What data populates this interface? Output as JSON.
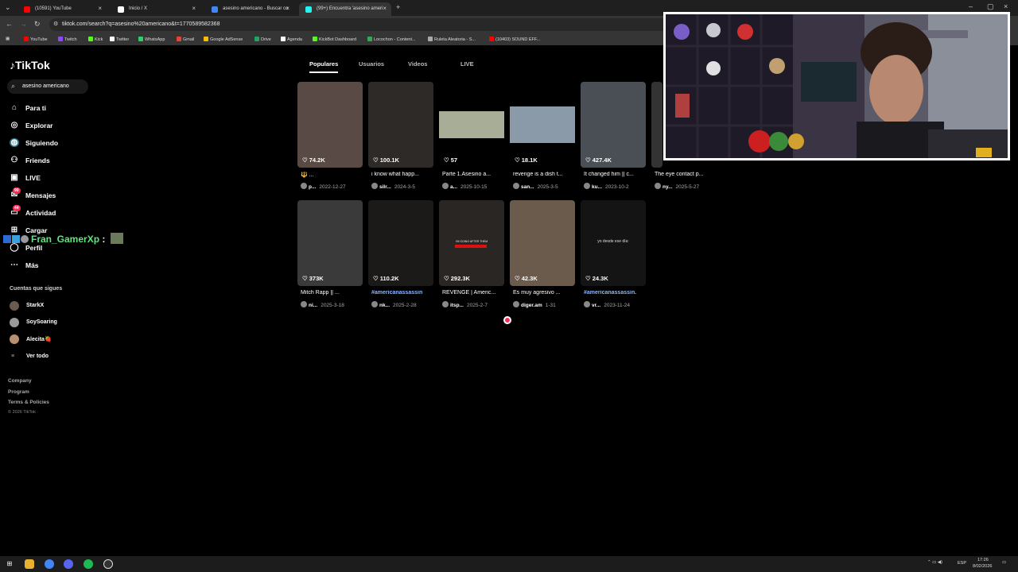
{
  "browser": {
    "tabs": [
      {
        "title": "(10591) YouTube",
        "active": false,
        "color": "#ff0000"
      },
      {
        "title": "Inicio / X",
        "active": false,
        "color": "#ffffff"
      },
      {
        "title": "asesino americano - Buscar co",
        "active": false,
        "color": "#4285f4"
      },
      {
        "title": "(99+) Encuentra 'asesino ameri",
        "active": true,
        "color": "#25f4ee"
      }
    ],
    "url": "tiktok.com/search?q=asesino%20americano&t=1770589582368",
    "bookmarks": [
      {
        "label": "YouTube",
        "color": "#ff0000"
      },
      {
        "label": "Twitch",
        "color": "#9146ff"
      },
      {
        "label": "Kick",
        "color": "#53fc18"
      },
      {
        "label": "Twitter",
        "color": "#ffffff"
      },
      {
        "label": "WhatsApp",
        "color": "#25d366"
      },
      {
        "label": "Gmail",
        "color": "#ea4335"
      },
      {
        "label": "Google AdSense",
        "color": "#fbbc04"
      },
      {
        "label": "Drive",
        "color": "#1fa463"
      },
      {
        "label": "Agenda",
        "color": "#ffffff"
      },
      {
        "label": "KickBot Dashboard",
        "color": "#53fc18"
      },
      {
        "label": "Locochon - Content...",
        "color": "#34a853"
      },
      {
        "label": "Ruleta Aleatoria - S...",
        "color": "#aaaaaa"
      },
      {
        "label": "(10403) SOUND EFF...",
        "color": "#ff0000"
      }
    ]
  },
  "sidebar": {
    "logo": "TikTok",
    "search_value": "asesino americano",
    "items": [
      {
        "label": "Para ti",
        "icon": "home-icon"
      },
      {
        "label": "Explorar",
        "icon": "compass-icon"
      },
      {
        "label": "Siguiendo",
        "icon": "following-icon"
      },
      {
        "label": "Friends",
        "icon": "friends-icon"
      },
      {
        "label": "LIVE",
        "icon": "live-icon"
      },
      {
        "label": "Mensajes",
        "icon": "message-icon",
        "badge": "99"
      },
      {
        "label": "Actividad",
        "icon": "activity-icon",
        "badge": "44"
      },
      {
        "label": "Cargar",
        "icon": "upload-icon"
      },
      {
        "label": "Perfil",
        "icon": "profile-icon"
      },
      {
        "label": "Más",
        "icon": "more-icon"
      }
    ],
    "following_title": "Cuentas que sigues",
    "following": [
      "StarkX",
      "SoySoaring",
      "Alecita🍓"
    ],
    "see_all": "Ver todo",
    "footer": [
      "Company",
      "Program",
      "Terms & Policies"
    ],
    "copyright": "© 2026 TikTok"
  },
  "overlay_chat": {
    "user": "Fran_GamerXp",
    "sep": ":"
  },
  "search_tabs": [
    "Populares",
    "Usuarios",
    "Videos",
    "LIVE"
  ],
  "videos": [
    {
      "likes": "74.2K",
      "desc": "🔱 ...",
      "user": "p...",
      "date": "2022-12-27",
      "tag": false,
      "thumb": "#5a4a45"
    },
    {
      "likes": "100.1K",
      "desc": "i know what happ...",
      "user": "silr...",
      "date": "2024-3-5",
      "tag": false,
      "thumb": "#2e2a28"
    },
    {
      "likes": "57",
      "desc": "Parte 1.Asesino a...",
      "user": "a...",
      "date": "2025-10-15",
      "tag": false,
      "thumb": "#000000"
    },
    {
      "likes": "18.1K",
      "desc": "revenge is a dish t...",
      "user": "san...",
      "date": "2025-3-5",
      "tag": false,
      "thumb": "#000000"
    },
    {
      "likes": "427.4K",
      "desc": "It changed him || c...",
      "user": "ku...",
      "date": "2023-10-2",
      "tag": false,
      "thumb": "#4a4f55"
    },
    {
      "likes": "",
      "desc": "The eye contact p...",
      "user": "ny...",
      "date": "2025-5-27",
      "tag": false,
      "thumb": "#333333"
    },
    {
      "likes": "373K",
      "desc": "Mitch Rapp || ...",
      "user": "ni...",
      "date": "2025-3-18",
      "tag": false,
      "thumb": "#3a3a3a"
    },
    {
      "likes": "110.2K",
      "desc": "#americanassassin",
      "user": "nk...",
      "date": "2025-2-28",
      "tag": true,
      "thumb": "#1c1a19"
    },
    {
      "likes": "292.3K",
      "desc": "REVENGE | Americ...",
      "user": "itsp...",
      "date": "2025-2-7",
      "tag": false,
      "thumb": "#2a2624"
    },
    {
      "likes": "42.3K",
      "desc": "Es muy agresivo ...",
      "user": "diger.am",
      "date": "1-31",
      "tag": false,
      "thumb": "#6b5b4d"
    },
    {
      "likes": "24.3K",
      "desc": "#americanassassin.",
      "user": "vr...",
      "date": "2023-11-24",
      "tag": true,
      "thumb": "#141414",
      "overlay": "yo desde ese día:"
    }
  ],
  "thumb_caption_revenge": "I'M GOING AFTER THEM",
  "taskbar": {
    "lang": "ESP",
    "time": "17:26",
    "date": "8/02/2026"
  }
}
